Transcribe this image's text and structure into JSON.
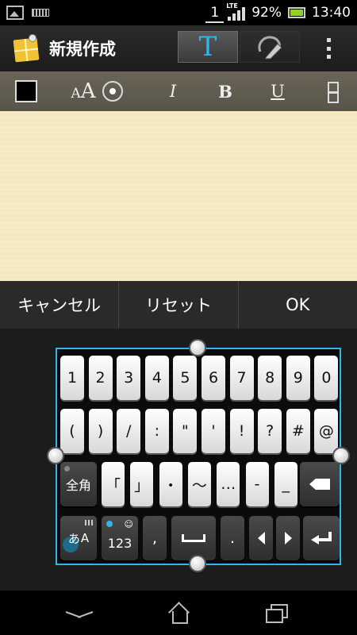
{
  "status_bar": {
    "sim_slot": "1",
    "network": "LTE",
    "battery": "92%",
    "time": "13:40",
    "icons": [
      "image-icon",
      "keyboard-icon",
      "signal-icon",
      "battery-icon"
    ],
    "battery_color": "#8ed31f"
  },
  "action_bar": {
    "title": "新規作成",
    "text_mode_glyph": "T",
    "modes": [
      "text-mode",
      "handwriting-mode"
    ],
    "accent_color": "#33b5e5"
  },
  "format_toolbar": {
    "text_color": "#000000",
    "font_size_small": "A",
    "font_size_large": "A",
    "italic": "I",
    "bold": "B",
    "underline": "U"
  },
  "note": {
    "text": "",
    "paper_color": "#f6ecc3"
  },
  "buttons": {
    "cancel": "キャンセル",
    "reset": "リセット",
    "ok": "OK"
  },
  "keyboard": {
    "row1": [
      "1",
      "2",
      "3",
      "4",
      "5",
      "6",
      "7",
      "8",
      "9",
      "0"
    ],
    "row2": [
      "(",
      ")",
      "/",
      ":",
      "\"",
      "'",
      "!",
      "?",
      "#",
      "@"
    ],
    "row3": {
      "fullwidth": "全角",
      "keys": [
        "「",
        "」",
        "・",
        "〜",
        "…",
        "-",
        "_"
      ]
    },
    "row4": {
      "kana_mode_a": "あ",
      "kana_mode_b": "A",
      "numeric_mode": "123",
      "comma": ",",
      "period": "."
    }
  },
  "nav_bar": {
    "icons": [
      "back-icon",
      "home-icon",
      "recent-apps-icon"
    ]
  }
}
